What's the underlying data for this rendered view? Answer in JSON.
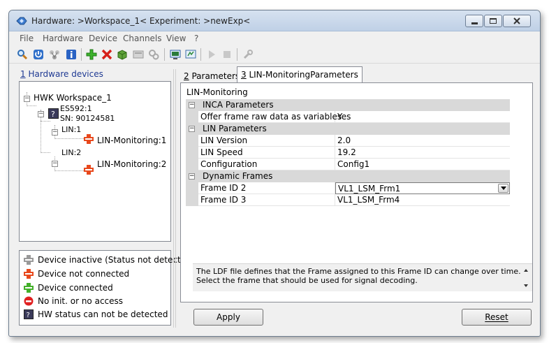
{
  "window": {
    "title": "Hardware: >Workspace_1<   Experiment: >newExp<"
  },
  "menu": [
    "File",
    "Hardware",
    "Device",
    "Channels",
    "View",
    "?"
  ],
  "toolbar": {
    "icons": [
      "search-icon",
      "power-icon",
      "network-icon",
      "info-icon",
      "add-icon",
      "remove-icon",
      "package-icon",
      "module-icon",
      "settings-icon",
      "monitor-icon",
      "monitor-refresh-icon",
      "play-icon",
      "stop-icon",
      "tools-icon"
    ]
  },
  "left_panel": {
    "header_num": "1",
    "header_text": " Hardware devices",
    "tree": {
      "workspace": "HWK Workspace_1",
      "device_line1": "ES592:1",
      "device_line2": "SN: 90124581",
      "lin1": "LIN:1",
      "lin1_child": "LIN-Monitoring:1",
      "lin2": "LIN:2",
      "lin2_child": "LIN-Monitoring:2"
    },
    "legend": [
      {
        "label": "Device inactive (Status not detected)",
        "color": "#9a9a9a"
      },
      {
        "label": "Device not connected",
        "color": "#e8491d"
      },
      {
        "label": "Device connected",
        "color": "#43b02a"
      },
      {
        "label": "No init. or no access",
        "color": "#e02020"
      },
      {
        "label": "HW status can not be detected",
        "color": "#555555"
      }
    ]
  },
  "tabs": [
    {
      "num": "2",
      "label": " Parameters"
    },
    {
      "num": "3",
      "label": " LIN-MonitoringParameters"
    }
  ],
  "panel": {
    "group_title": "LIN-Monitoring",
    "grid": {
      "inca_category": "INCA Parameters",
      "offer_name": "Offer frame raw data as variables",
      "offer_value": "Yes",
      "lin_category": "LIN Parameters",
      "version_name": "LIN Version",
      "version_value": "2.0",
      "speed_name": "LIN Speed",
      "speed_value": "19.2",
      "config_name": "Configuration",
      "config_value": "Config1",
      "dynamic_category": "Dynamic Frames",
      "frame2_name": "Frame ID 2",
      "frame2_value": "VL1_LSM_Frm1",
      "frame3_name": "Frame ID 3",
      "frame3_value": "VL1_LSM_Frm4"
    },
    "description_line1": "The LDF file defines that the Frame assigned to this Frame ID can change over time.",
    "description_line2": "Select the frame that should be used for signal decoding."
  },
  "buttons": {
    "apply": "Apply",
    "reset": "Reset"
  }
}
